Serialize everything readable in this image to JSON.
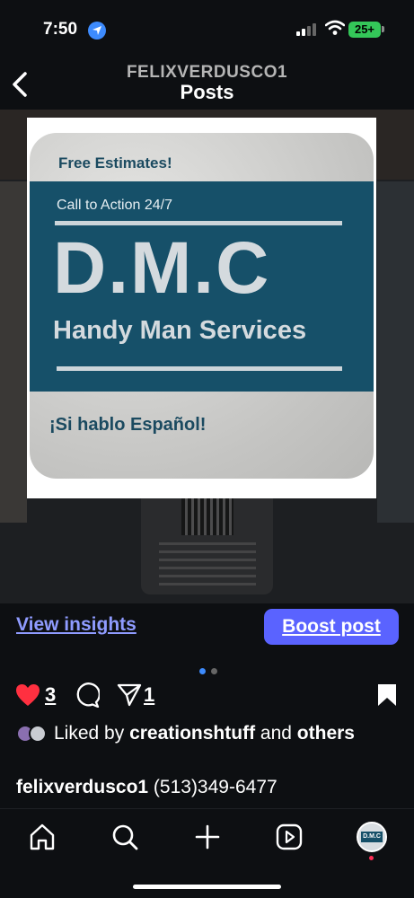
{
  "status_bar": {
    "time": "7:50",
    "battery": "25+"
  },
  "header": {
    "username": "FELIXVERDUSCO1",
    "title": "Posts"
  },
  "flyer": {
    "free_estimates": "Free Estimates!",
    "call_to_action": "Call to Action 24/7",
    "brand": "D.M.C",
    "service": "Handy Man Services",
    "spanish": "¡Si hablo Español!",
    "colors": {
      "band": "#165069",
      "text_dark": "#1b4a60"
    }
  },
  "actions": {
    "insights_label": "View insights",
    "boost_label": "Boost post"
  },
  "carousel": {
    "current": 1,
    "total": 2
  },
  "engagement": {
    "likes": "3",
    "shares": "1"
  },
  "liked_by": {
    "prefix": "Liked by ",
    "user": "creationshtuff",
    "middle": " and ",
    "others": "others"
  },
  "caption": {
    "user": "felixverdusco1",
    "text": " (513)349-6477"
  },
  "tabbar": {
    "items": [
      "home-icon",
      "search-icon",
      "create-icon",
      "reels-icon",
      "profile-avatar"
    ],
    "profile_text": "D.M.C"
  },
  "theme": {
    "accent": "#5a63ff",
    "link": "#8f9bff",
    "like": "#ff3040"
  }
}
